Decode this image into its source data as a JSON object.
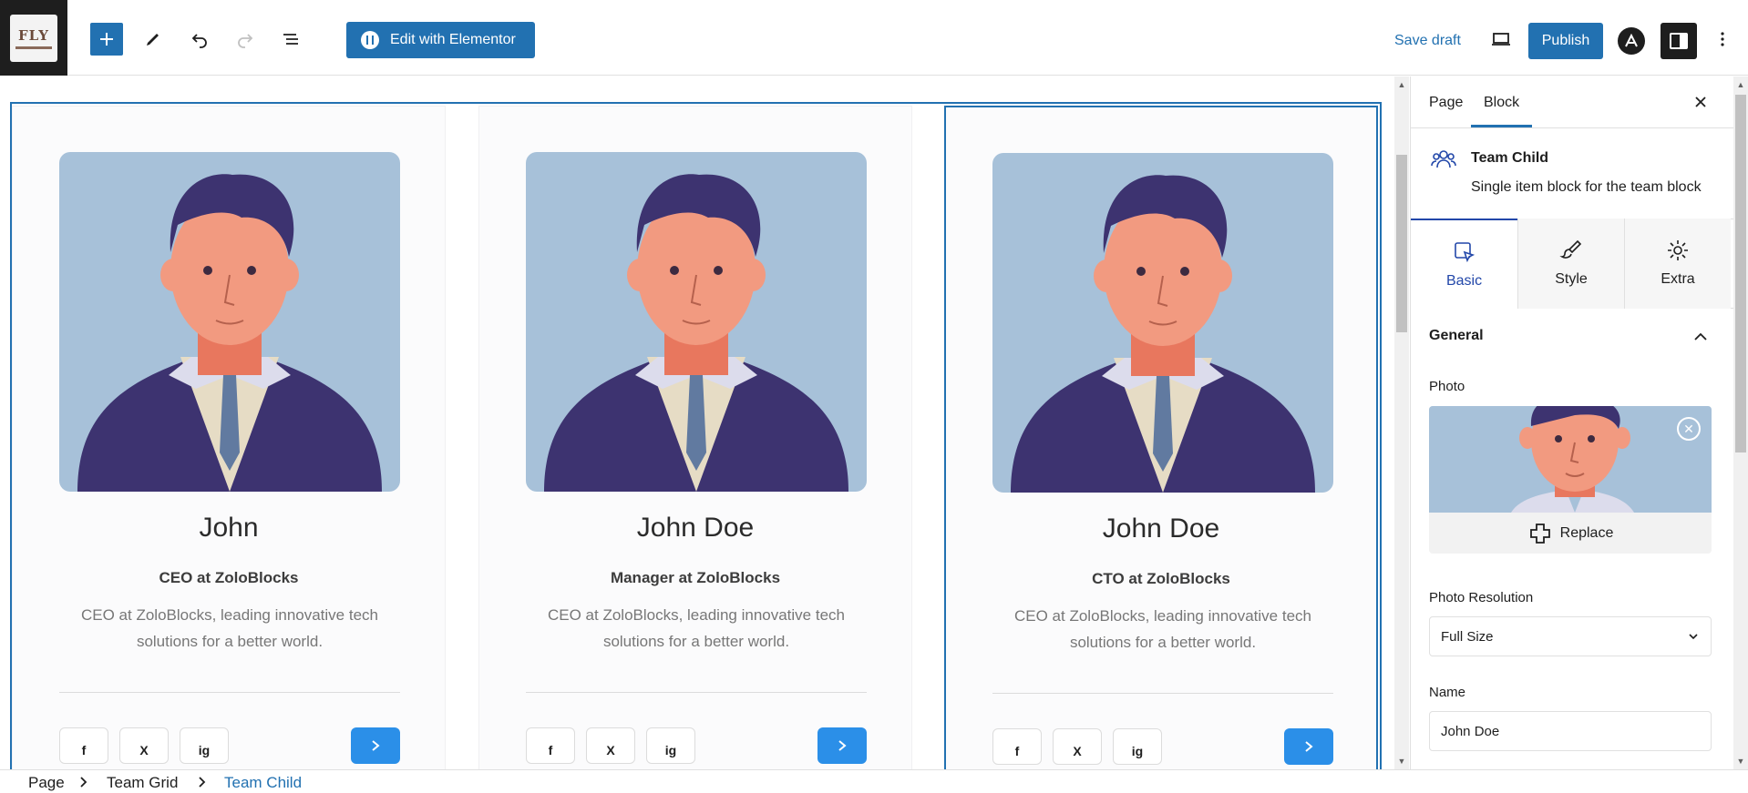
{
  "toolbar": {
    "logo_text": "FLY",
    "elementor_label": "Edit with Elementor",
    "save_draft_label": "Save draft",
    "publish_label": "Publish"
  },
  "cards": [
    {
      "name": "John",
      "role": "CEO at ZoloBlocks",
      "description": "CEO at ZoloBlocks, leading innovative tech solutions for a better world.",
      "social": [
        "f",
        "X",
        "ig"
      ]
    },
    {
      "name": "John Doe",
      "role": "Manager at ZoloBlocks",
      "description": "CEO at ZoloBlocks, leading innovative tech solutions for a better world.",
      "social": [
        "f",
        "X",
        "ig"
      ]
    },
    {
      "name": "John Doe",
      "role": "CTO at ZoloBlocks",
      "description": "CEO at ZoloBlocks, leading innovative tech solutions for a better world.",
      "social": [
        "f",
        "X",
        "ig"
      ]
    }
  ],
  "sidebar": {
    "tabs": [
      "Page",
      "Block"
    ],
    "active_tab": "Block",
    "block": {
      "title": "Team Child",
      "description": "Single item block for the team block"
    },
    "inspector_tabs": [
      {
        "label": "Basic",
        "icon": "cursor-select-icon",
        "active": true
      },
      {
        "label": "Style",
        "icon": "brush-icon",
        "active": false
      },
      {
        "label": "Extra",
        "icon": "gear-icon",
        "active": false
      }
    ],
    "panel": {
      "title": "General",
      "photo_label": "Photo",
      "replace_label": "Replace",
      "resolution_label": "Photo Resolution",
      "resolution_value": "Full Size",
      "name_label": "Name",
      "name_value": "John Doe"
    }
  },
  "breadcrumbs": [
    "Page",
    "Team Grid",
    "Team Child"
  ],
  "colors": {
    "accent": "#2271b1",
    "photo_bg": "#a7c1d9",
    "suit": "#3d3370",
    "skin": "#f29a80",
    "arrow_button": "#2b8fe8"
  }
}
